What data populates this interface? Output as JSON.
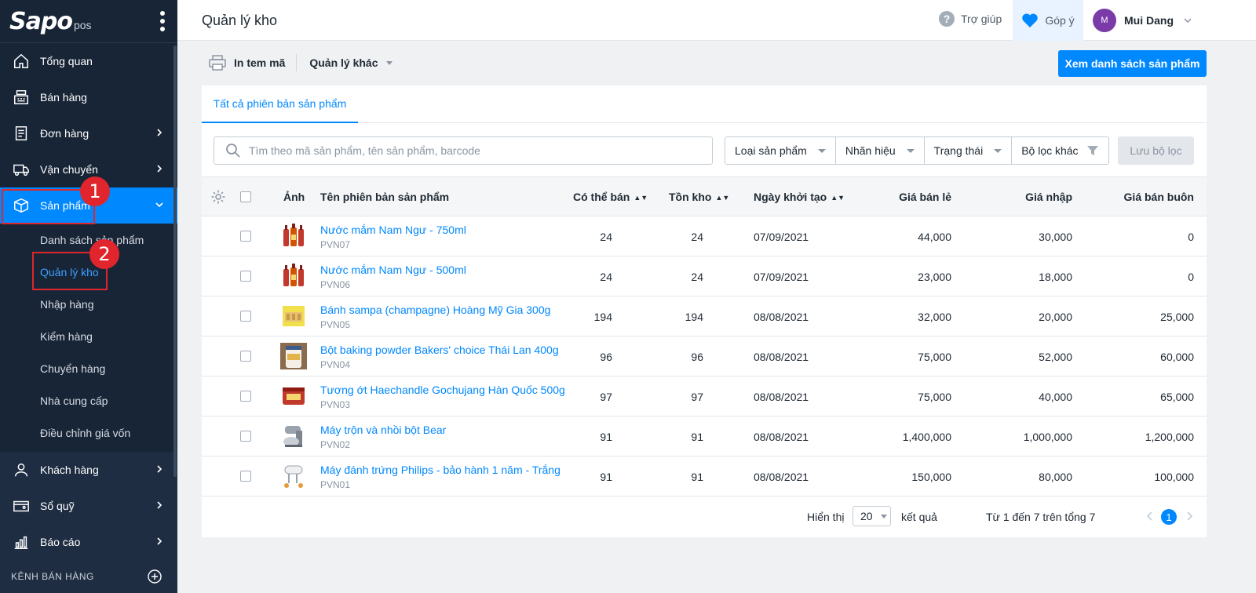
{
  "brand": {
    "logo": "Sapo",
    "suffix": "pos"
  },
  "sidebar": {
    "items": [
      {
        "label": "Tổng quan",
        "icon": "home-icon"
      },
      {
        "label": "Bán hàng",
        "icon": "cash-register-icon"
      },
      {
        "label": "Đơn hàng",
        "icon": "order-icon"
      },
      {
        "label": "Vận chuyển",
        "icon": "truck-icon"
      },
      {
        "label": "Sản phẩm",
        "icon": "box-icon"
      }
    ],
    "sub_items": [
      "Danh sách sản phẩm",
      "Quản lý kho",
      "Nhập hàng",
      "Kiểm hàng",
      "Chuyển hàng",
      "Nhà cung cấp",
      "Điều chỉnh giá vốn"
    ],
    "lower_items": [
      {
        "label": "Khách hàng",
        "icon": "user-icon"
      },
      {
        "label": "Sổ quỹ",
        "icon": "cashbook-icon"
      },
      {
        "label": "Báo cáo",
        "icon": "report-icon"
      }
    ],
    "channel_label": "KÊNH BÁN HÀNG"
  },
  "annotations": {
    "mark1": "1",
    "mark2": "2",
    "color": "#e0262c"
  },
  "topbar": {
    "title": "Quản lý kho",
    "help": "Trợ giúp",
    "feedback": "Góp ý",
    "avatar": "M",
    "user": "Mui Dang"
  },
  "toolbar": {
    "print": "In tem mã",
    "other": "Quản lý khác",
    "view_products": "Xem danh sách sản phẩm"
  },
  "tabs": {
    "all_variants": "Tất cả phiên bản sản phẩm"
  },
  "search": {
    "placeholder": "Tìm theo mã sản phẩm, tên sản phẩm, barcode"
  },
  "filters": [
    "Loại sản phẩm",
    "Nhãn hiệu",
    "Trạng thái",
    "Bộ lọc khác"
  ],
  "save_filter": "Lưu bộ lọc",
  "table": {
    "headers": {
      "image": "Ảnh",
      "name": "Tên phiên bản sản phẩm",
      "available": "Có thể bán",
      "stock": "Tồn kho",
      "created": "Ngày khởi tạo",
      "retail": "Giá bán lẻ",
      "import": "Giá nhập",
      "wholesale": "Giá bán buôn"
    },
    "rows": [
      {
        "name": "Nước mắm Nam Ngư - 750ml",
        "sku": "PVN07",
        "available": "24",
        "stock": "24",
        "created": "07/09/2021",
        "retail": "44,000",
        "import": "30,000",
        "wholesale": "0",
        "thumb": "fish-sauce"
      },
      {
        "name": "Nước mắm Nam Ngư - 500ml",
        "sku": "PVN06",
        "available": "24",
        "stock": "24",
        "created": "07/09/2021",
        "retail": "23,000",
        "import": "18,000",
        "wholesale": "0",
        "thumb": "fish-sauce"
      },
      {
        "name": "Bánh sampa (champagne) Hoàng Mỹ Gia 300g",
        "sku": "PVN05",
        "available": "194",
        "stock": "194",
        "created": "08/08/2021",
        "retail": "32,000",
        "import": "20,000",
        "wholesale": "25,000",
        "thumb": "biscuit"
      },
      {
        "name": "Bột baking powder Bakers' choice Thái Lan 400g",
        "sku": "PVN04",
        "available": "96",
        "stock": "96",
        "created": "08/08/2021",
        "retail": "75,000",
        "import": "52,000",
        "wholesale": "60,000",
        "thumb": "jar"
      },
      {
        "name": "Tương ớt Haechandle Gochujang Hàn Quốc 500g",
        "sku": "PVN03",
        "available": "97",
        "stock": "97",
        "created": "08/08/2021",
        "retail": "75,000",
        "import": "40,000",
        "wholesale": "65,000",
        "thumb": "red-tub"
      },
      {
        "name": "Máy trộn và nhồi bột Bear",
        "sku": "PVN02",
        "available": "91",
        "stock": "91",
        "created": "08/08/2021",
        "retail": "1,400,000",
        "import": "1,000,000",
        "wholesale": "1,200,000",
        "thumb": "mixer"
      },
      {
        "name": "Máy đánh trứng Philips - bảo hành 1 năm - Trắng",
        "sku": "PVN01",
        "available": "91",
        "stock": "91",
        "created": "08/08/2021",
        "retail": "150,000",
        "import": "80,000",
        "wholesale": "100,000",
        "thumb": "hand-mixer"
      }
    ]
  },
  "pagination": {
    "show": "Hiển thị",
    "per_page": "20",
    "results": "kết quả",
    "range": "Từ 1 đến 7 trên tổng 7",
    "current": "1"
  },
  "colors": {
    "primary": "#0088ff",
    "sidebar": "#182537"
  }
}
